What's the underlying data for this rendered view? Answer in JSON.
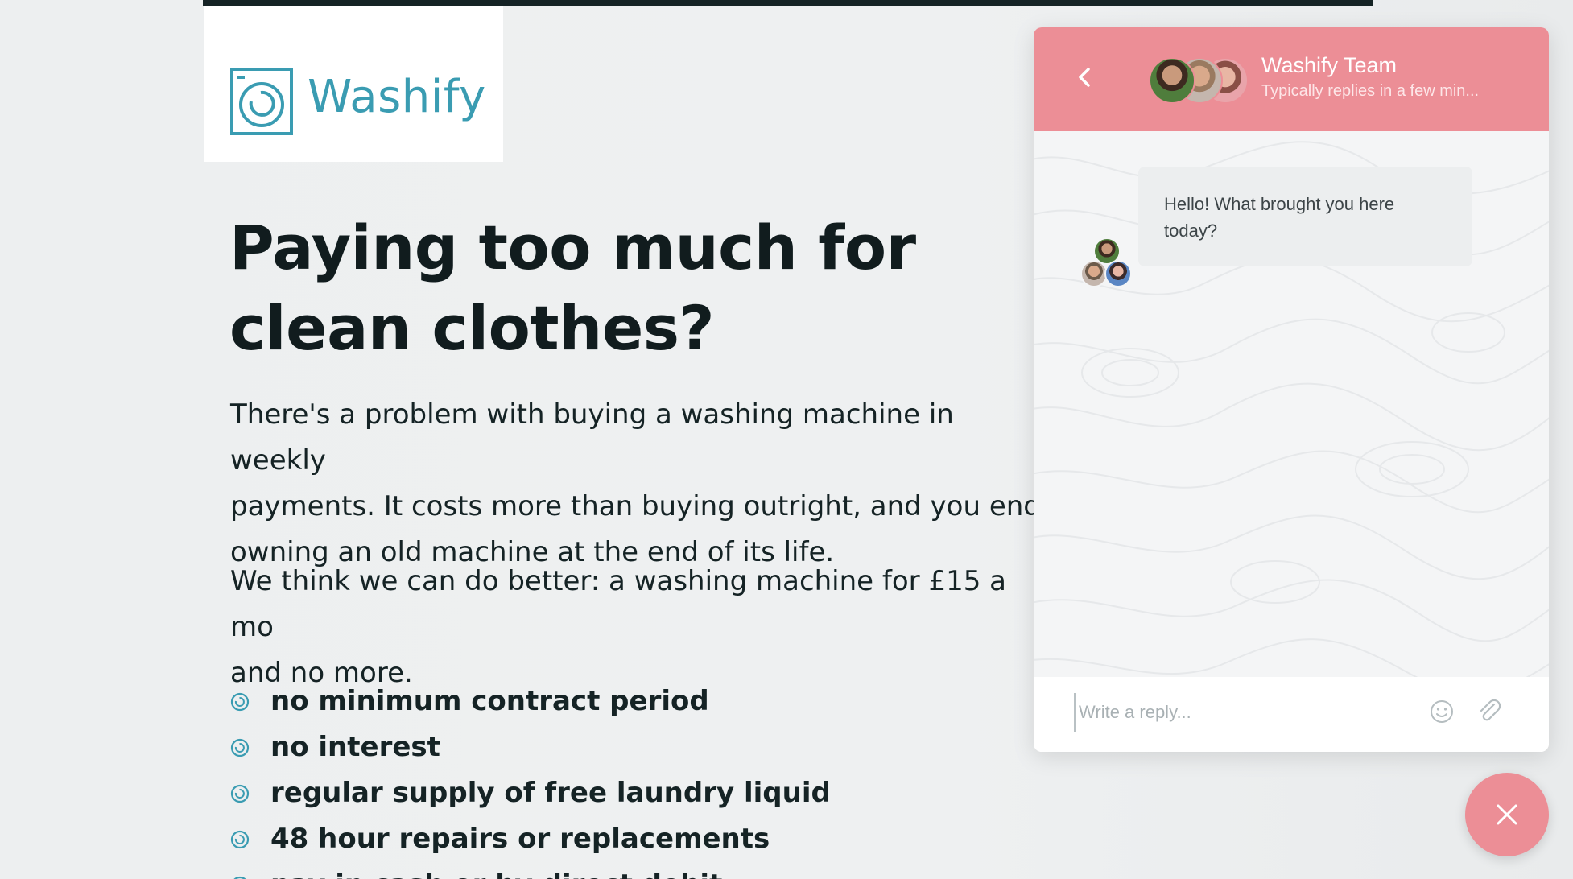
{
  "brand": {
    "name": "Washify",
    "accent_color": "#3a9cb2",
    "logo_icon": "washing-machine-icon"
  },
  "hero": {
    "headline_line1": "Paying too much for",
    "headline_line2": "clean clothes?",
    "paragraph1_line1": "There's a problem with buying a washing machine in weekly",
    "paragraph1_line2": "payments. It costs more than buying outright, and you end",
    "paragraph1_line3": "owning an old machine at the end of its life.",
    "paragraph2_line1": "We think we can do better: a washing machine for £15 a mo",
    "paragraph2_line2": "and no more.",
    "bullets": [
      "no minimum contract period",
      "no interest",
      "regular supply of free laundry liquid",
      "48 hour repairs or replacements",
      "pay in cash or by direct debit"
    ]
  },
  "chat": {
    "header_color": "#ec8e96",
    "team_name": "Washify Team",
    "team_subtitle": "Typically replies in a few min...",
    "back_icon": "chevron-left-icon",
    "message": "Hello! What brought you here today?",
    "reply_placeholder": "Write a reply...",
    "emoji_icon": "smiley-icon",
    "attach_icon": "paperclip-icon"
  },
  "launcher": {
    "icon": "close-icon"
  }
}
